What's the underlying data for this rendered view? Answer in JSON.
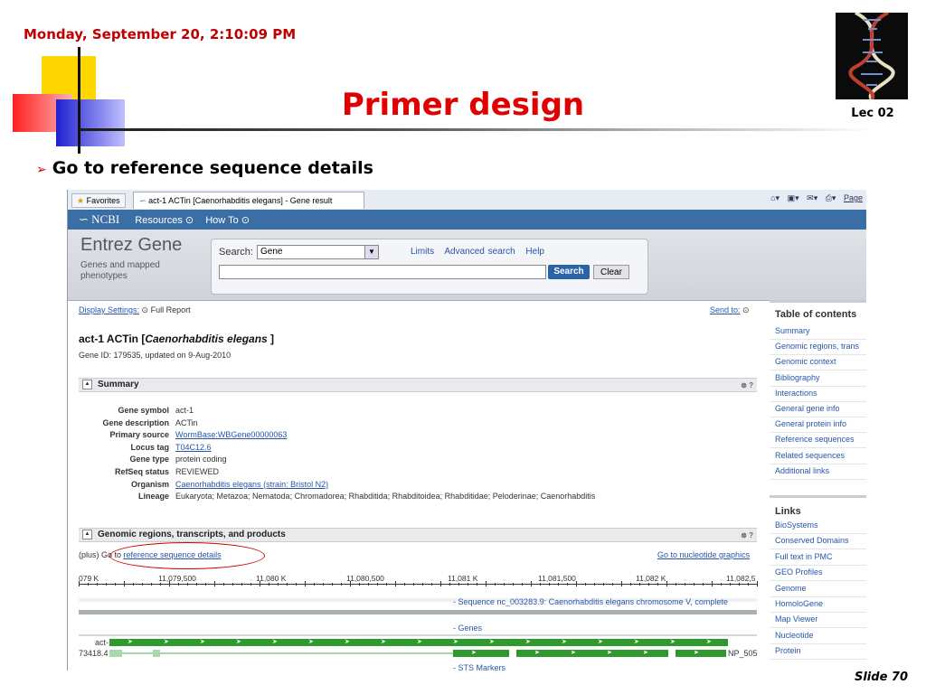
{
  "slide": {
    "datetime": "Monday, September 20, 2:10:09 PM",
    "title": "Primer design",
    "lecture": "Lec 02",
    "bullet": "Go to reference sequence details",
    "slide_number": "Slide 70",
    "colors": {
      "title": "#e00000",
      "date": "#c00000",
      "accent_yellow": "#ffd700",
      "accent_blue": "#3030e0",
      "accent_red": "#ff3030"
    }
  },
  "browser": {
    "favorites": "Favorites",
    "tab_title": "act-1 ACTin [Caenorhabditis elegans] - Gene result",
    "page_menu": "Page"
  },
  "ncbi": {
    "logo": "NCBI",
    "resources": "Resources",
    "howto": "How To"
  },
  "entrez": {
    "title": "Entrez Gene",
    "subtitle": "Genes and mapped phenotypes",
    "search_label": "Search:",
    "search_db": "Gene",
    "limits": "Limits",
    "advanced": "Advanced search",
    "help": "Help",
    "search_button": "Search",
    "clear_button": "Clear"
  },
  "report": {
    "display_settings": "Display Settings:",
    "full_report": "Full Report",
    "send_to": "Send to:",
    "gene_name": "act-1 ACTin [",
    "organism_italic": "Caenorhabditis elegans",
    "gene_name_end": " ]",
    "gene_id": "Gene ID: 179535, updated on 9-Aug-2010",
    "summary_heading": "Summary",
    "summary": [
      {
        "key": "Gene symbol",
        "value": "act-1",
        "link": false
      },
      {
        "key": "Gene description",
        "value": "ACTin",
        "link": false
      },
      {
        "key": "Primary source",
        "value": "WormBase:WBGene00000063",
        "link": true
      },
      {
        "key": "Locus tag",
        "value": "T04C12.6",
        "link": true
      },
      {
        "key": "Gene type",
        "value": "protein coding",
        "link": false
      },
      {
        "key": "RefSeq status",
        "value": "REVIEWED",
        "link": false
      },
      {
        "key": "Organism",
        "value": "Caenorhabditis elegans (strain: Bristol N2)",
        "link": true
      },
      {
        "key": "Lineage",
        "value": "Eukaryota; Metazoa; Nematoda; Chromadorea; Rhabditida; Rhabditoidea; Rhabditidae; Peloderinae; Caenorhabditis",
        "link": false
      }
    ],
    "genomic_heading": "Genomic regions, transcripts, and products",
    "plus_prefix": "(plus) Go to ",
    "refseq_link": "reference sequence details",
    "nuc_link": "Go to nucleotide graphics",
    "ruler_labels": [
      "079 K",
      "11,079,500",
      "11,080 K",
      "11,080,500",
      "11,081 K",
      "11,081,500",
      "11,082 K",
      "11,082,5"
    ],
    "seq_track": "- Sequence nc_003283.9: Caenorhabditis elegans chromosome V, complete",
    "genes_track": "- Genes",
    "gene_label": "act-1",
    "transcript_label": "73418.4",
    "protein_label": "NP_505",
    "sts_track": "- STS Markers"
  },
  "sidebar": {
    "toc_title": "Table of contents",
    "toc": [
      "Summary",
      "Genomic regions, trans",
      "Genomic context",
      "Bibliography",
      "Interactions",
      "General gene info",
      "General protein info",
      "Reference sequences",
      "Related sequences",
      "Additional links"
    ],
    "links_title": "Links",
    "links": [
      "BioSystems",
      "Conserved Domains",
      "Full text in PMC",
      "GEO Profiles",
      "Genome",
      "HomoloGene",
      "Map Viewer",
      "Nucleotide",
      "Protein"
    ]
  }
}
